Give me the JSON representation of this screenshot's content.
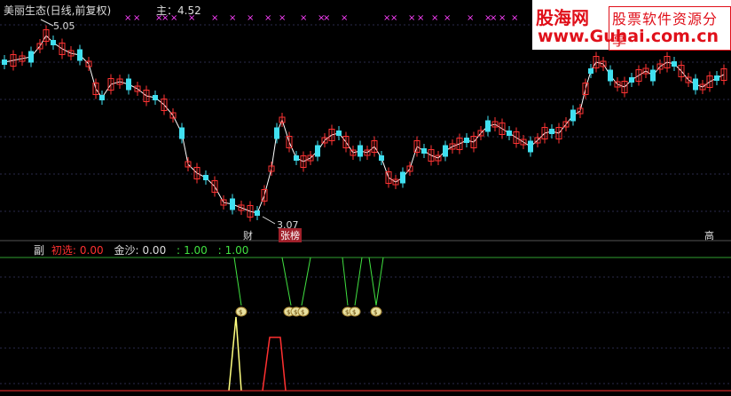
{
  "window": {
    "title": "美丽生态(日线,前复权)",
    "price_line": "主：4.52"
  },
  "annotations": {
    "high": "5.05",
    "low": "3.07"
  },
  "events": [
    {
      "label": "财",
      "style": "plain"
    },
    {
      "label": "张榜",
      "style": "red"
    },
    {
      "label": "高",
      "style": "plain"
    }
  ],
  "watermark": {
    "logo": "股海网",
    "slogan": "股票软件资源分享",
    "url": "www.Guhai.com.cn"
  },
  "sub_panel": {
    "name": "副",
    "legend": [
      {
        "label": "初选:",
        "value": "0.00",
        "color": "#ff3030"
      },
      {
        "label": "金沙:",
        "value": "0.00",
        "color": "#dddddd"
      },
      {
        "label": ":",
        "value": "1.00",
        "color": "#40e040"
      },
      {
        "label": ":",
        "value": "1.00",
        "color": "#40e040"
      }
    ]
  },
  "colors": {
    "up": "#ff3333",
    "down": "#40e0f0",
    "line": "#ffffff",
    "signal_green": "#40e040",
    "signal_yellow": "#ffff80",
    "signal_red": "#ff3030",
    "marker": "#ff40ff"
  },
  "icons": {
    "signal": "money-bag-icon",
    "top_marker": "x-marker-icon"
  }
}
